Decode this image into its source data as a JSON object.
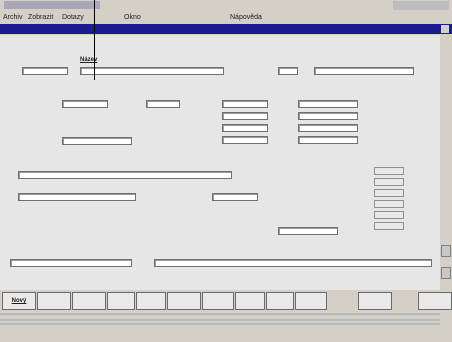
{
  "window": {
    "title": ""
  },
  "menu": [
    {
      "label": "Archiv"
    },
    {
      "label": "Zobrazit"
    },
    {
      "label": "Dotazy"
    },
    {
      "label": "Okno"
    },
    {
      "label": ""
    },
    {
      "label": ""
    },
    {
      "label": "Nápověda"
    }
  ],
  "header": {
    "left": "",
    "right": ""
  },
  "form": {
    "labels": {
      "cis": "",
      "nazev": "Název",
      "kat": "",
      "kat_name": "",
      "dat_posl": "",
      "mnozstvi": "",
      "posl_pohyb": "",
      "cena_prodej": "",
      "cena_nakup": "",
      "cena_zbozi": "",
      "uctova_sk": "",
      "dodavatel": "",
      "vyrobce": "",
      "prod_cena": "",
      "posl_zmena": "",
      "kontakt": "",
      "poznamka": ""
    },
    "values": {
      "cis": "",
      "nazev": "",
      "kat": "",
      "kat_name": "",
      "dat_posl": "",
      "mnozstvi": "",
      "nakup_cena": "",
      "uctova_sk": "",
      "dodavatel": "",
      "vyrobce": "",
      "posl_zmena": "",
      "prod_cena": "",
      "kontakt": "",
      "poznamka": ""
    },
    "mid_cells": [
      "",
      "",
      "",
      ""
    ],
    "price_cells": [
      "",
      "",
      "",
      ""
    ],
    "right_cells": [
      "",
      "",
      "",
      "",
      "",
      ""
    ]
  },
  "toolbar": [
    {
      "label": "Nový",
      "enabled": true
    },
    {
      "label": "",
      "enabled": true
    },
    {
      "label": "",
      "enabled": true
    },
    {
      "label": "",
      "enabled": true
    },
    {
      "label": "",
      "enabled": true
    },
    {
      "label": "",
      "enabled": true
    },
    {
      "label": "",
      "enabled": true
    },
    {
      "label": "",
      "enabled": true
    },
    {
      "label": "",
      "enabled": true
    },
    {
      "label": "",
      "enabled": true
    },
    {
      "label": "",
      "enabled": false
    },
    {
      "label": "",
      "enabled": true
    }
  ],
  "status": {
    "product": "",
    "date": "",
    "mode": "",
    "caps": "",
    "num": "",
    "time": ""
  }
}
